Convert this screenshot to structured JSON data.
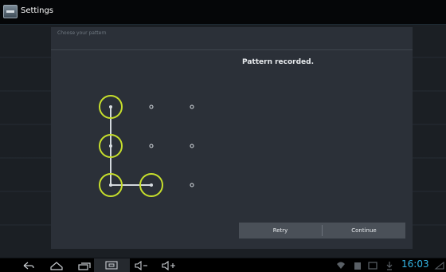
{
  "action_bar": {
    "title": "Settings"
  },
  "panel": {
    "header": "Choose your pattern",
    "status": "Pattern recorded."
  },
  "buttons": {
    "retry": "Retry",
    "continue": "Continue"
  },
  "navigation_bar": {
    "clock": "16:03"
  },
  "colors": {
    "pattern_circle": "#c7df2c",
    "clock": "#33b5e5"
  },
  "pattern": {
    "selected_sequence": [
      1,
      4,
      7,
      8
    ]
  }
}
